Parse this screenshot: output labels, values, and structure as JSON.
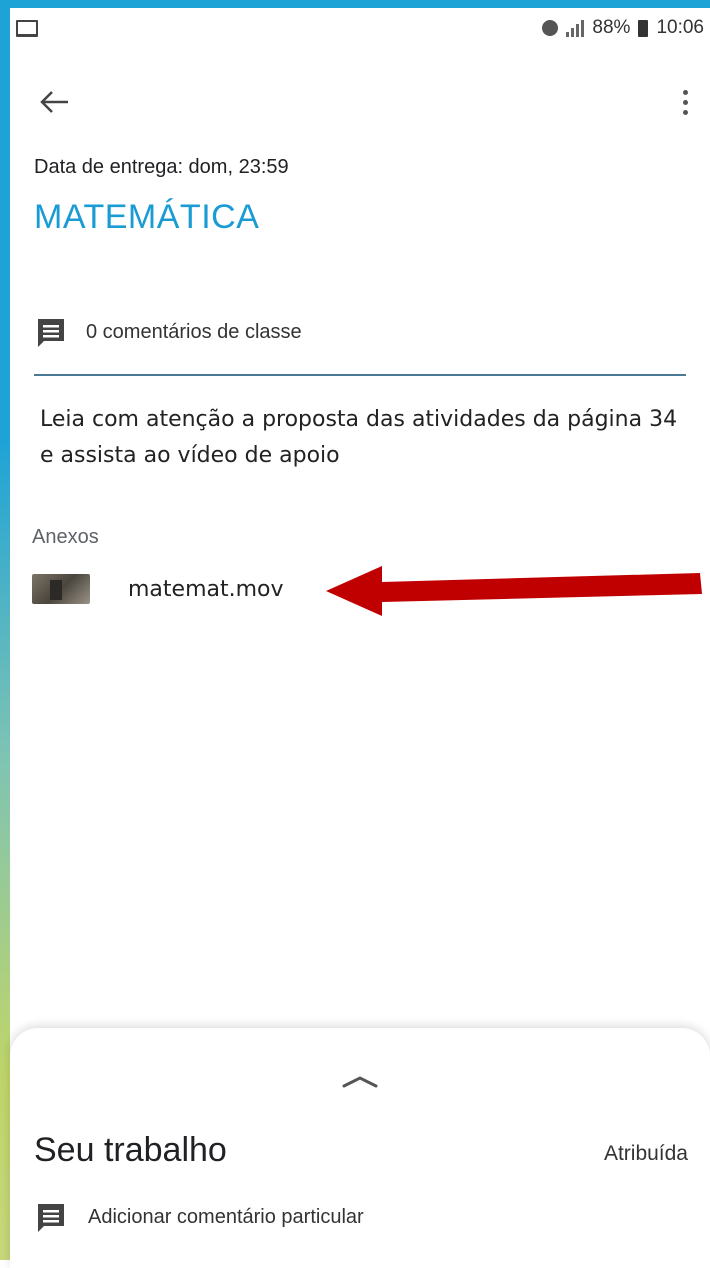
{
  "status_bar": {
    "left_icon": "laptop-icon",
    "battery_text": "88%",
    "time": "10:06"
  },
  "app_bar": {
    "back_icon": "arrow-left-icon",
    "menu_icon": "more-vert-icon"
  },
  "assignment": {
    "due_date": "Data de entrega: dom, 23:59",
    "title": "MATEMÁTICA",
    "comments": "0 comentários de classe",
    "instructions": "Leia com atenção a proposta das atividades da página 34 e assista ao vídeo de apoio"
  },
  "attachments": {
    "label": "Anexos",
    "items": [
      {
        "name": "matemat.mov",
        "icon": "video-thumbnail"
      }
    ]
  },
  "your_work": {
    "title": "Seu trabalho",
    "status": "Atribuída",
    "private_comment": "Adicionar comentário particular"
  },
  "colors": {
    "accent": "#1a9bd4",
    "annotation_arrow": "#c00000",
    "divider": "#4a7a96"
  }
}
